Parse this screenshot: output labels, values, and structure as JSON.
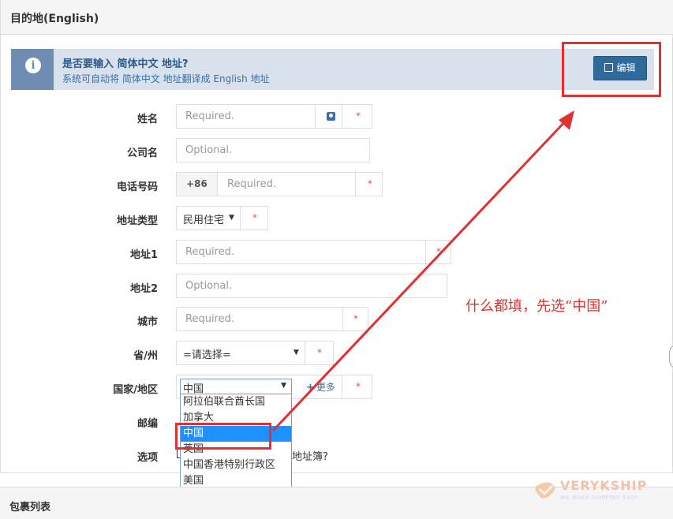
{
  "panel": {
    "title": "目的地(English)"
  },
  "alert": {
    "title": "是否要输入 简体中文 地址?",
    "subtitle": "系统可自动将 简体中文 地址翻译成 English 地址",
    "edit_label": "编辑"
  },
  "form": {
    "name": {
      "label": "姓名",
      "placeholder": "Required."
    },
    "company": {
      "label": "公司名",
      "placeholder": "Optional."
    },
    "phone": {
      "label": "电话号码",
      "prefix": "+86",
      "placeholder": "Required."
    },
    "address_type": {
      "label": "地址类型",
      "value": "民用住宅"
    },
    "address1": {
      "label": "地址1",
      "placeholder": "Required."
    },
    "address2": {
      "label": "地址2",
      "placeholder": "Optional."
    },
    "city": {
      "label": "城市",
      "placeholder": "Required."
    },
    "province": {
      "label": "省/州",
      "value": "=请选择="
    },
    "country": {
      "label": "国家/地区",
      "value": "中国",
      "more_label": "更多",
      "options": [
        "阿拉伯联合酋长国",
        "加拿大",
        "中国",
        "英国",
        "中国香港特别行政区",
        "美国"
      ],
      "selected_index": 2
    },
    "postcode": {
      "label": "邮编"
    },
    "options": {
      "label": "选项",
      "trailing_text": "地址簿?"
    },
    "required_mark": "*"
  },
  "annotation": "什么都填，先选“中国”",
  "packages": {
    "title": "包裹列表"
  },
  "brand": {
    "name": "VERYKSHIP",
    "tagline": "WE MAKE SHIPPING EASY"
  },
  "colors": {
    "accent": "#2f6a9e",
    "highlight": "#e03030",
    "required": "#d9534f"
  }
}
